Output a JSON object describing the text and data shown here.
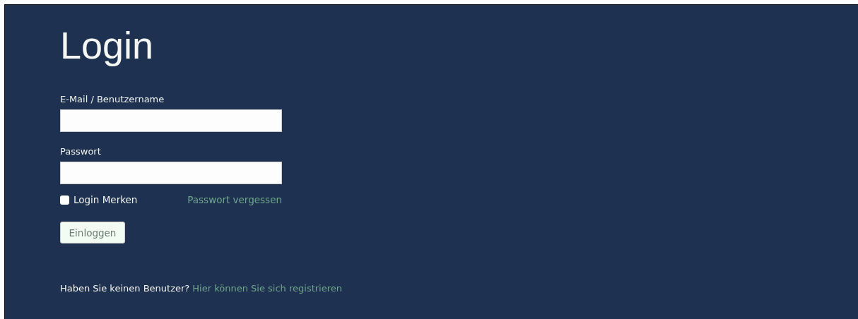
{
  "title": "Login",
  "fields": [
    {
      "label": "E-Mail / Benutzername"
    },
    {
      "label": "Passwort"
    }
  ],
  "remember": {
    "label": "Login Merken",
    "checked": false
  },
  "forgot_link": "Passwort vergessen",
  "submit_button": "Einloggen",
  "footer": {
    "text": "Haben Sie keinen Benutzer?",
    "link": "Hier können Sie sich registrieren"
  }
}
